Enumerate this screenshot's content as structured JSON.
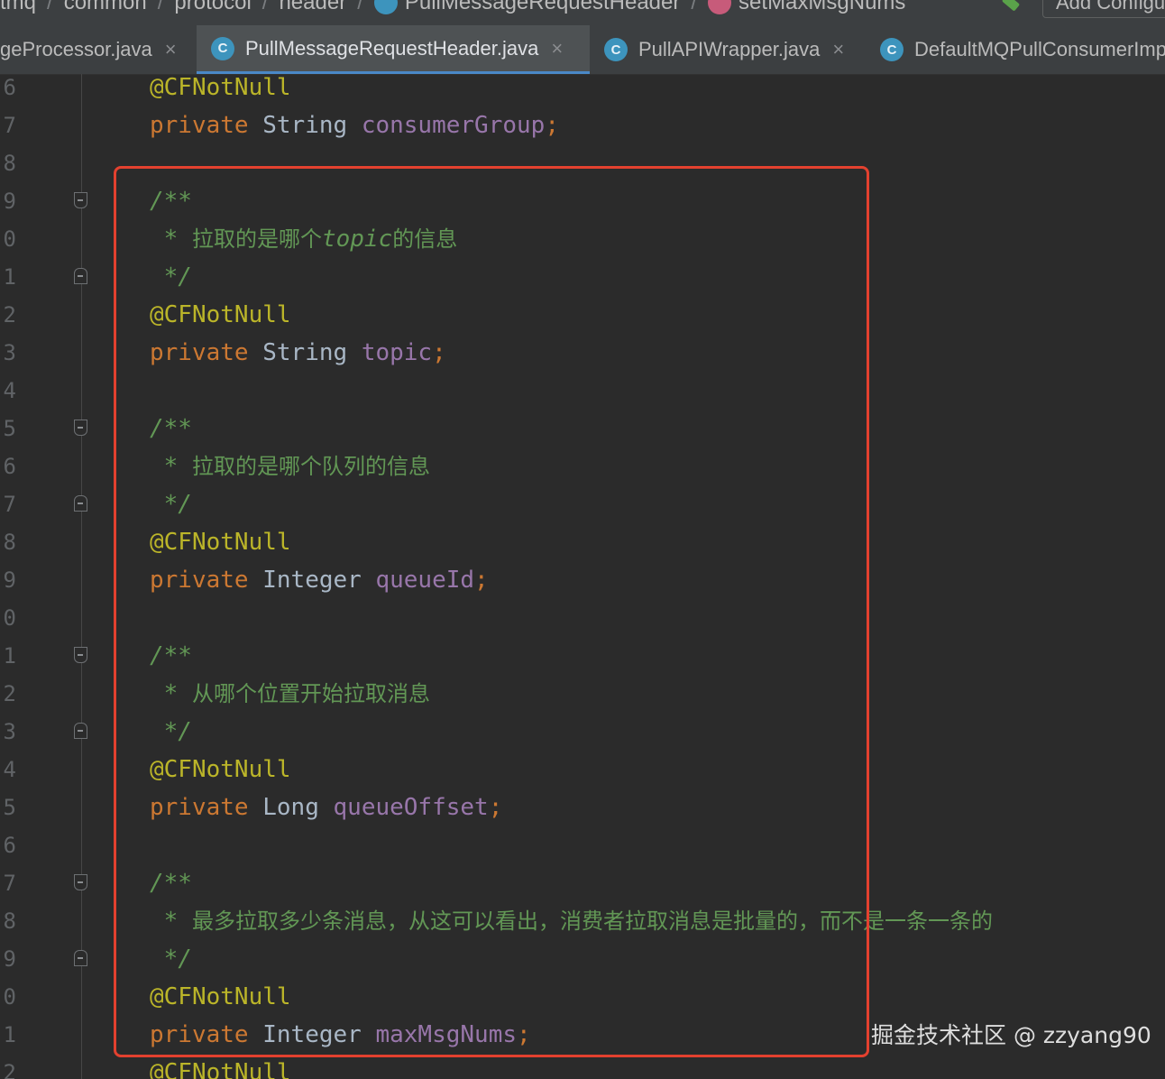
{
  "breadcrumb": {
    "items": [
      "tmq",
      "common",
      "protocol",
      "header",
      "PullMessageRequestHeader",
      "setMaxMsgNums"
    ],
    "separator": "/",
    "add_config_label": "Add Configu"
  },
  "tabs": [
    {
      "label": "geProcessor.java",
      "close": "×",
      "active": false
    },
    {
      "label": "PullMessageRequestHeader.java",
      "close": "×",
      "active": true,
      "icon": "C"
    },
    {
      "label": "PullAPIWrapper.java",
      "close": "×",
      "active": false,
      "icon": "C"
    },
    {
      "label": "DefaultMQPullConsumerImp",
      "close": "",
      "active": false,
      "icon": "C"
    }
  ],
  "editor": {
    "line_numbers": [
      "6",
      "7",
      "8",
      "9",
      "0",
      "1",
      "2",
      "3",
      "4",
      "5",
      "6",
      "7",
      "8",
      "9",
      "0",
      "1",
      "2",
      "3",
      "4",
      "5",
      "6",
      "7",
      "8",
      "9",
      "0",
      "1",
      "2"
    ],
    "lines": [
      {
        "annotation": "@CFNotNull"
      },
      {
        "keyword": "private",
        "type": "String",
        "name": "consumerGroup",
        "semi": ";"
      },
      {},
      {
        "doc_open": "/**"
      },
      {
        "doc_star": " * ",
        "doc_text_a": "拉取的是哪个",
        "doc_text_b": "topic",
        "doc_text_c": "的信息"
      },
      {
        "doc_close": " */"
      },
      {
        "annotation": "@CFNotNull"
      },
      {
        "keyword": "private",
        "type": "String",
        "name": "topic",
        "semi": ";"
      },
      {},
      {
        "doc_open": "/**"
      },
      {
        "doc_star": " * ",
        "doc_text_a": "拉取的是哪个队列的信息"
      },
      {
        "doc_close": " */"
      },
      {
        "annotation": "@CFNotNull"
      },
      {
        "keyword": "private",
        "type": "Integer",
        "name": "queueId",
        "semi": ";"
      },
      {},
      {
        "doc_open": "/**"
      },
      {
        "doc_star": " * ",
        "doc_text_a": "从哪个位置开始拉取消息"
      },
      {
        "doc_close": " */"
      },
      {
        "annotation": "@CFNotNull"
      },
      {
        "keyword": "private",
        "type": "Long",
        "name": "queueOffset",
        "semi": ";"
      },
      {},
      {
        "doc_open": "/**"
      },
      {
        "doc_star": " * ",
        "doc_text_a": "最多拉取多少条消息，从这可以看出，消费者拉取消息是批量的，而不是一条一条的"
      },
      {
        "doc_close": " */"
      },
      {
        "annotation": "@CFNotNull"
      },
      {
        "keyword": "private",
        "type": "Integer",
        "name": "maxMsgNums",
        "semi": ";"
      },
      {
        "annotation": "@CFNotNull"
      }
    ]
  },
  "watermark": "掘金技术社区 @ zzyang90",
  "colors": {
    "editor_bg": "#2b2b2b",
    "keyword": "#cc7832",
    "type": "#a9b7c6",
    "field": "#9876aa",
    "annotation": "#bbb529",
    "doc_comment": "#629755",
    "highlight_border": "#e3412f",
    "active_tab_underline": "#4a88c7"
  }
}
